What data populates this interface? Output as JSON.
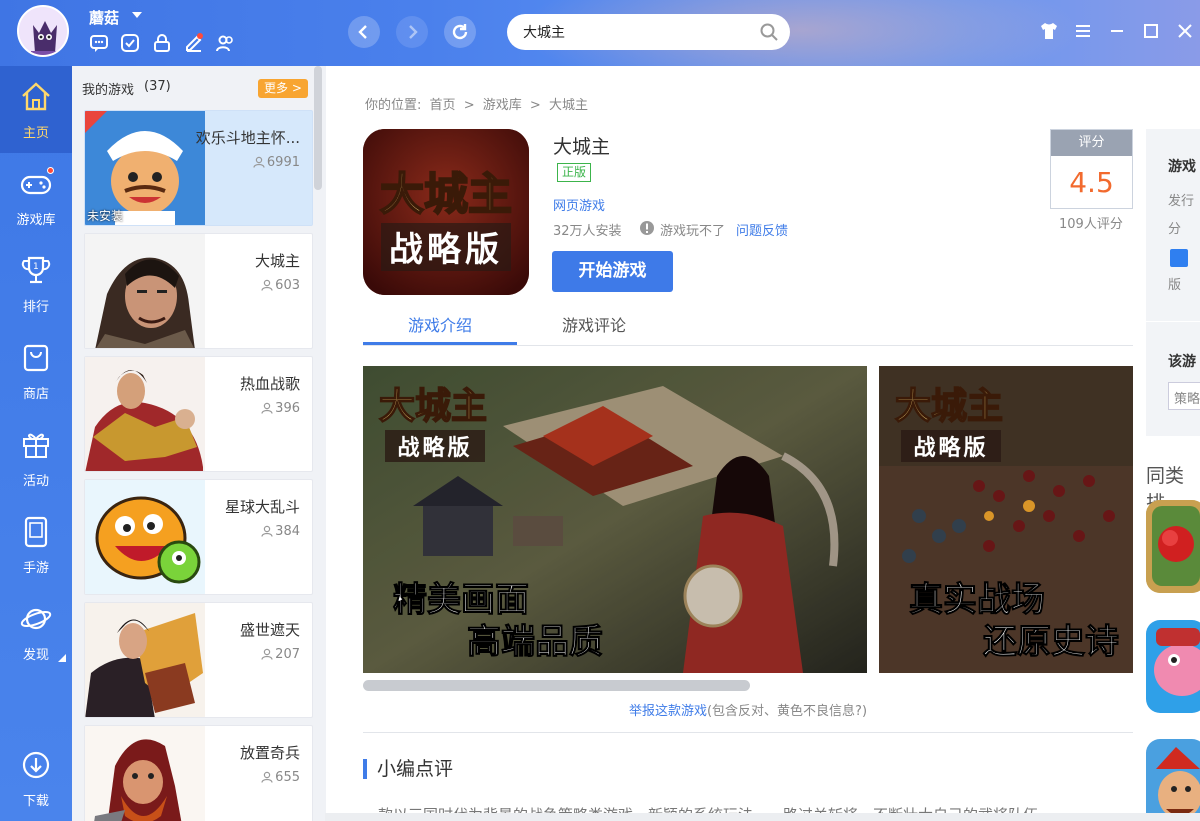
{
  "top": {
    "username": "蘑菇",
    "search_value": "大城主"
  },
  "nav": {
    "items": [
      {
        "label": "主页",
        "icon": "home-icon"
      },
      {
        "label": "游戏库",
        "icon": "gamepad-icon"
      },
      {
        "label": "排行",
        "icon": "trophy-icon"
      },
      {
        "label": "商店",
        "icon": "shop-bag-icon"
      },
      {
        "label": "活动",
        "icon": "gift-icon"
      },
      {
        "label": "手游",
        "icon": "phone-icon"
      },
      {
        "label": "发现",
        "icon": "planet-icon"
      },
      {
        "label": "下载",
        "icon": "download-icon"
      }
    ]
  },
  "my_games": {
    "title": "我的游戏",
    "count": "(37)",
    "more": "更多 >",
    "not_installed": "未安装",
    "games": [
      {
        "name": "欢乐斗地主怀...",
        "players": "6991"
      },
      {
        "name": "大城主",
        "players": "603"
      },
      {
        "name": "热血战歌",
        "players": "396"
      },
      {
        "name": "星球大乱斗",
        "players": "384"
      },
      {
        "name": "盛世遮天",
        "players": "207"
      },
      {
        "name": "放置奇兵",
        "players": "655"
      }
    ]
  },
  "breadcrumb": {
    "prefix": "你的位置:",
    "items": [
      "首页",
      "游戏库",
      "大城主"
    ],
    "sep": ">"
  },
  "game": {
    "title": "大城主",
    "badge": "正版",
    "type": "网页游戏",
    "installs": "32万人安装",
    "cant_play": "游戏玩不了",
    "feedback": "问题反馈",
    "start": "开始游戏",
    "icon_title": "大城主",
    "icon_sub": "战略版"
  },
  "score": {
    "label": "评分",
    "value": "4.5",
    "count": "109人评分"
  },
  "tabs": [
    "游戏介绍",
    "游戏评论"
  ],
  "screenshots": [
    {
      "logo": "大城主",
      "logo_sub": "战略版",
      "line1": "精美画面",
      "line2": "高端品质"
    },
    {
      "logo": "大城主",
      "logo_sub": "战略版",
      "line1": "真实战场",
      "line2": "还原史诗"
    }
  ],
  "report": {
    "link": "举报这款游戏",
    "note": "(包含反对、黄色不良信息?)"
  },
  "review": {
    "heading": "小编点评",
    "text": "一款以三国时代为背景的战争策略类游戏，新颖的系统玩法，一路过关斩将，不断壮大自己的武将队伍，"
  },
  "right": {
    "t1": "游戏",
    "t2": "发行",
    "t3": "分",
    "t4": "版",
    "t5": "该游",
    "input": "策略",
    "similar": "同类排"
  },
  "colors": {
    "accent": "#3f7ce8",
    "score": "#f26a2e",
    "badge": "#3cb44b",
    "more": "#f8a531"
  }
}
